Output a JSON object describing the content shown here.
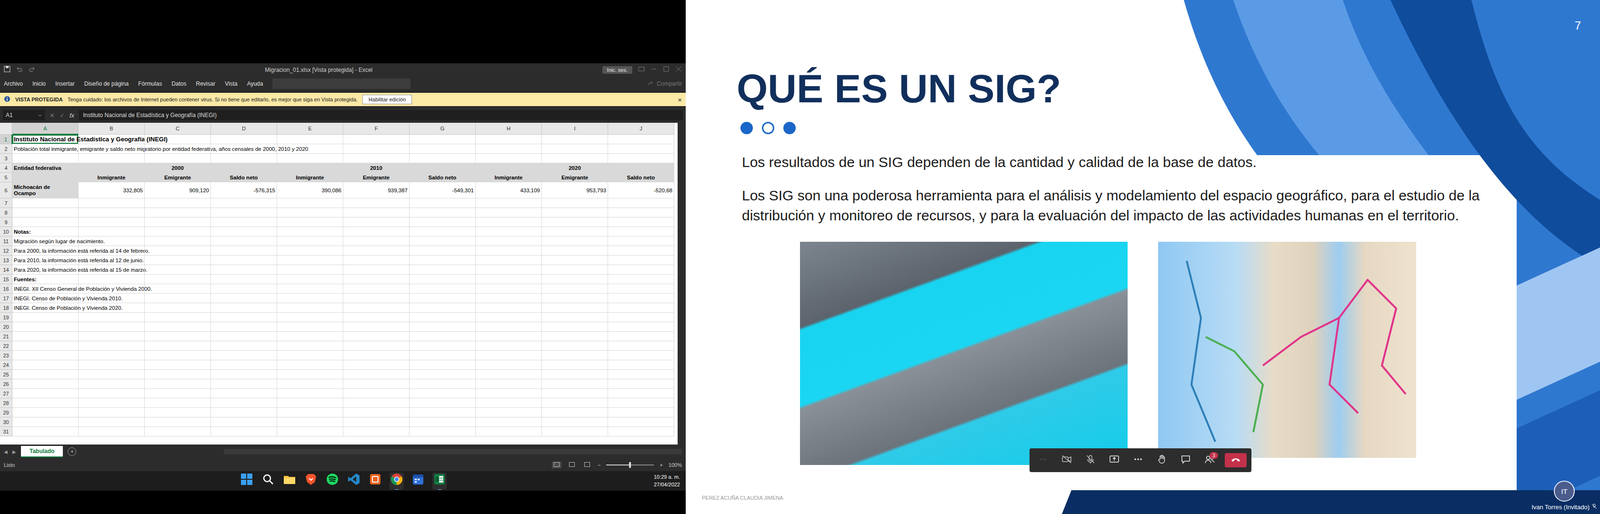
{
  "excel": {
    "title": "Migracion_01.xlsx [Vista protegida] - Excel",
    "account_button": "Inic. ses.",
    "menu": [
      "Archivo",
      "Inicio",
      "Insertar",
      "Diseño de página",
      "Fórmulas",
      "Datos",
      "Revisar",
      "Vista",
      "Ayuda"
    ],
    "share": "Compartir",
    "protected_view": {
      "label": "VISTA PROTEGIDA",
      "message": "Tenga cuidado: los archivos de Internet pueden contener virus. Si no tiene que editarlo, es mejor que siga en Vista protegida.",
      "button": "Habilitar edición",
      "close": "×"
    },
    "name_box": "A1",
    "formula_buttons": [
      "✕",
      "✓"
    ],
    "formula_fx": "fx",
    "formula": "Instituto Nacional de Estadística y Geografía (INEGI)",
    "columns": [
      {
        "label": "A",
        "selected": true
      },
      {
        "label": "B",
        "selected": false
      },
      {
        "label": "C",
        "selected": false
      },
      {
        "label": "D",
        "selected": false
      },
      {
        "label": "E",
        "selected": false
      },
      {
        "label": "F",
        "selected": false
      },
      {
        "label": "G",
        "selected": false
      },
      {
        "label": "H",
        "selected": false
      },
      {
        "label": "I",
        "selected": false
      },
      {
        "label": "J",
        "selected": false
      }
    ],
    "rows": [
      {
        "num": "1",
        "kind": "title",
        "selected": true,
        "cells": [
          "Instituto Nacional de Estadística y Geografía (INEGI)"
        ]
      },
      {
        "num": "2",
        "kind": "subtitle",
        "selected": false,
        "cells": [
          "Población total inmigrante, emigrante y saldo neto migratorio por entidad federativa, años censales de 2000, 2010 y 2020"
        ]
      },
      {
        "num": "3",
        "kind": "blank",
        "selected": false,
        "cells": []
      },
      {
        "num": "4",
        "kind": "h1",
        "selected": false,
        "cells": [
          "Entidad federativa",
          "",
          "2000",
          "",
          "",
          "2010",
          "",
          "",
          "2020",
          ""
        ]
      },
      {
        "num": "5",
        "kind": "h2",
        "selected": false,
        "cells": [
          "",
          "Inmigrante",
          "Emigrante",
          "Saldo neto",
          "Inmigrante",
          "Emigrante",
          "Saldo neto",
          "Inmigrante",
          "Emigrante",
          "Saldo neto"
        ]
      },
      {
        "num": "6",
        "kind": "data",
        "selected": false,
        "cells": [
          "Michoacán de Ocampo",
          "332,805",
          "909,120",
          "-576,315",
          "390,086",
          "939,387",
          "-549,301",
          "433,109",
          "953,793",
          "-520,68"
        ]
      },
      {
        "num": "7",
        "kind": "blank",
        "selected": false,
        "cells": []
      },
      {
        "num": "8",
        "kind": "blank",
        "selected": false,
        "cells": []
      },
      {
        "num": "9",
        "kind": "blank",
        "selected": false,
        "cells": []
      },
      {
        "num": "10",
        "kind": "notehead",
        "selected": false,
        "cells": [
          "Notas:"
        ]
      },
      {
        "num": "11",
        "kind": "note",
        "selected": false,
        "cells": [
          "Migración según lugar de nacimiento."
        ]
      },
      {
        "num": "12",
        "kind": "note",
        "selected": false,
        "cells": [
          "Para 2000, la información está referida al 14 de febrero."
        ]
      },
      {
        "num": "13",
        "kind": "note",
        "selected": false,
        "cells": [
          "Para 2010, la información está referida al 12 de junio."
        ]
      },
      {
        "num": "14",
        "kind": "note",
        "selected": false,
        "cells": [
          "Para 2020, la información está referida al 15 de marzo."
        ]
      },
      {
        "num": "15",
        "kind": "notehead",
        "selected": false,
        "cells": [
          "Fuentes:"
        ]
      },
      {
        "num": "16",
        "kind": "note",
        "selected": false,
        "cells": [
          "INEGI. XII Censo General de Población y Vivienda 2000."
        ]
      },
      {
        "num": "17",
        "kind": "note",
        "selected": false,
        "cells": [
          "INEGI. Censo de Población y Vivienda 2010."
        ]
      },
      {
        "num": "18",
        "kind": "note",
        "selected": false,
        "cells": [
          "INEGI. Censo de Población y Vivienda 2020."
        ]
      },
      {
        "num": "19",
        "kind": "blank",
        "selected": false,
        "cells": []
      },
      {
        "num": "20",
        "kind": "blank",
        "selected": false,
        "cells": []
      },
      {
        "num": "21",
        "kind": "blank",
        "selected": false,
        "cells": []
      },
      {
        "num": "22",
        "kind": "blank",
        "selected": false,
        "cells": []
      },
      {
        "num": "23",
        "kind": "blank",
        "selected": false,
        "cells": []
      },
      {
        "num": "24",
        "kind": "blank",
        "selected": false,
        "cells": []
      },
      {
        "num": "25",
        "kind": "blank",
        "selected": false,
        "cells": []
      },
      {
        "num": "26",
        "kind": "blank",
        "selected": false,
        "cells": []
      },
      {
        "num": "27",
        "kind": "blank",
        "selected": false,
        "cells": []
      },
      {
        "num": "28",
        "kind": "blank",
        "selected": false,
        "cells": []
      },
      {
        "num": "29",
        "kind": "blank",
        "selected": false,
        "cells": []
      },
      {
        "num": "30",
        "kind": "blank",
        "selected": false,
        "cells": []
      },
      {
        "num": "31",
        "kind": "blank",
        "selected": false,
        "cells": []
      }
    ],
    "sheet_nav": [
      "◀",
      "▶"
    ],
    "sheets": [
      {
        "label": "Tabulado",
        "selected": true
      }
    ],
    "add_sheet": "+",
    "status": "Listo",
    "views": [
      {
        "selected": true
      },
      {
        "selected": false
      },
      {
        "selected": false
      }
    ],
    "zoom": {
      "minus": "−",
      "plus": "+",
      "level": 0.5,
      "reading": "100%"
    }
  },
  "taskbar": {
    "apps": [
      {
        "kind": "windows",
        "running": false
      },
      {
        "kind": "search",
        "running": false
      },
      {
        "kind": "explorer",
        "running": false
      },
      {
        "kind": "brave",
        "running": false
      },
      {
        "kind": "spotify",
        "running": false
      },
      {
        "kind": "vscode",
        "running": false
      },
      {
        "kind": "orange",
        "running": false
      },
      {
        "kind": "chrome",
        "running": true
      },
      {
        "kind": "calendar",
        "running": false
      },
      {
        "kind": "excel",
        "running": true
      }
    ],
    "time": "10:29 a. m.",
    "date": "27/04/2022"
  },
  "slide": {
    "page": "7",
    "title": "QUÉ ES UN SIG?",
    "dots": [
      {
        "filled": true
      },
      {
        "filled": false
      },
      {
        "filled": true
      }
    ],
    "paragraphs": [
      "Los resultados de un SIG dependen de la cantidad y calidad de la base de datos.",
      "Los SIG son una poderosa herramienta para el análisis y modelamiento del espacio geográfico, para el estudio de la distribución y monitoreo de recursos, y para la evaluación del impacto de las actividades humanas en el territorio."
    ],
    "footer": "PEREZ ACUÑA CLAUDIA JIMENA"
  },
  "meeting": {
    "toolbar": [
      {
        "kind": "dots",
        "disabled": true
      },
      {
        "kind": "camera-off",
        "disabled": false
      },
      {
        "kind": "mic-off",
        "disabled": false
      },
      {
        "kind": "share",
        "disabled": false
      },
      {
        "kind": "more",
        "disabled": false
      },
      {
        "kind": "hand",
        "disabled": false
      },
      {
        "kind": "chat",
        "disabled": false
      },
      {
        "kind": "people",
        "disabled": false,
        "badge": "3"
      },
      {
        "kind": "hangup",
        "disabled": false
      }
    ],
    "participant": {
      "initials": "IT",
      "name": "Ivan Torres (Invitado)"
    }
  }
}
